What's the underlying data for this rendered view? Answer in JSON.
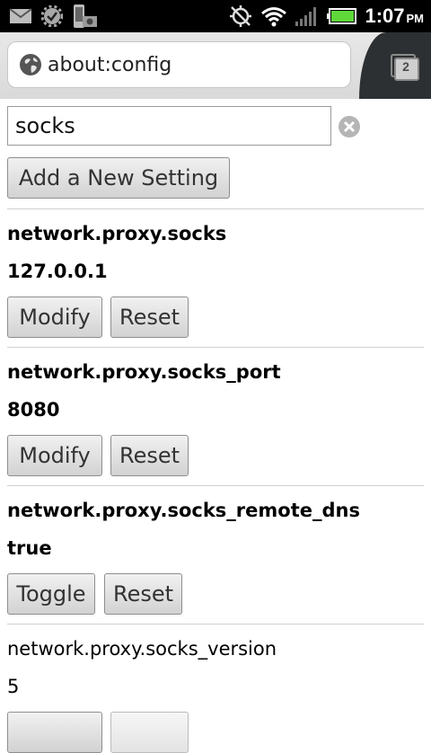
{
  "status_bar": {
    "time": "1:07",
    "ampm": "PM",
    "icons": [
      "gmail-icon",
      "settings-update-icon",
      "phone-storage-icon",
      "gps-off-icon",
      "wifi-icon",
      "signal-icon",
      "battery-icon"
    ]
  },
  "browser": {
    "url": "about:config",
    "tab_count": "2"
  },
  "search": {
    "value": "socks"
  },
  "add_setting_label": "Add a New Setting",
  "prefs": [
    {
      "name": "network.proxy.socks",
      "value": "127.0.0.1",
      "primary_action": "Modify",
      "reset_label": "Reset",
      "modified": true
    },
    {
      "name": "network.proxy.socks_port",
      "value": "8080",
      "primary_action": "Modify",
      "reset_label": "Reset",
      "modified": true
    },
    {
      "name": "network.proxy.socks_remote_dns",
      "value": "true",
      "primary_action": "Toggle",
      "reset_label": "Reset",
      "modified": true
    },
    {
      "name": "network.proxy.socks_version",
      "value": "5",
      "modified": false
    }
  ],
  "colors": {
    "status_bar_bg": "#000000",
    "battery_green": "#5fd83a",
    "toolbar_bg": "#dcdcdc",
    "tabs_bg": "#2d3032"
  }
}
